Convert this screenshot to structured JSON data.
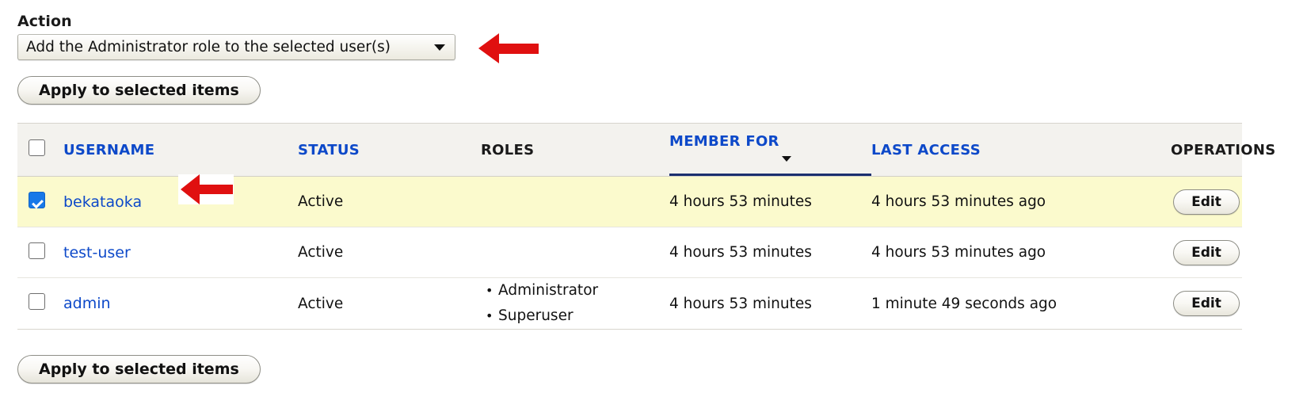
{
  "action": {
    "label": "Action",
    "select_value": "Add the Administrator role to the selected user(s)",
    "select_arrow_icon": "chevron-down-icon",
    "apply_top_label": "Apply to selected items",
    "apply_bottom_label": "Apply to selected items"
  },
  "colors": {
    "link_blue": "#0d49c9",
    "selected_row_yellow": "#fbfacd",
    "header_background": "#f3f2ee",
    "active_sort_underline": "#1b2f6e",
    "annotation_red": "#e01010",
    "checkbox_checked": "#1778e8"
  },
  "table": {
    "select_all_checkbox": {
      "name": "select-all-checkbox",
      "checked": false
    },
    "columns": [
      {
        "label": "USERNAME",
        "sortable": true,
        "active_sort": false
      },
      {
        "label": "STATUS",
        "sortable": true,
        "active_sort": false
      },
      {
        "label": "ROLES",
        "sortable": false,
        "active_sort": false
      },
      {
        "label": "MEMBER FOR",
        "sortable": true,
        "active_sort": true,
        "sort_direction_icon": "sort-descending-arrow"
      },
      {
        "label": "LAST ACCESS",
        "sortable": true,
        "active_sort": false
      },
      {
        "label": "OPERATIONS",
        "sortable": false,
        "active_sort": false
      }
    ],
    "rows": [
      {
        "checked": true,
        "selected": true,
        "username": "bekataoka",
        "status": "Active",
        "roles": [],
        "member_for": "4 hours 53 minutes",
        "last_access": "4 hours 53 minutes ago",
        "operation_label": "Edit"
      },
      {
        "checked": false,
        "selected": false,
        "username": "test-user",
        "status": "Active",
        "roles": [],
        "member_for": "4 hours 53 minutes",
        "last_access": "4 hours 53 minutes ago",
        "operation_label": "Edit"
      },
      {
        "checked": false,
        "selected": false,
        "username": "admin",
        "status": "Active",
        "roles": [
          "Administrator",
          "Superuser"
        ],
        "member_for": "4 hours 53 minutes",
        "last_access": "1 minute 49 seconds ago",
        "operation_label": "Edit"
      }
    ]
  },
  "annotations": [
    {
      "name": "annotation-arrow-action-select",
      "icon": "left-arrow-icon",
      "points_to": "action-select"
    },
    {
      "name": "annotation-arrow-selected-row",
      "icon": "left-arrow-icon",
      "points_to": "row-bekataoka-checkbox"
    }
  ]
}
